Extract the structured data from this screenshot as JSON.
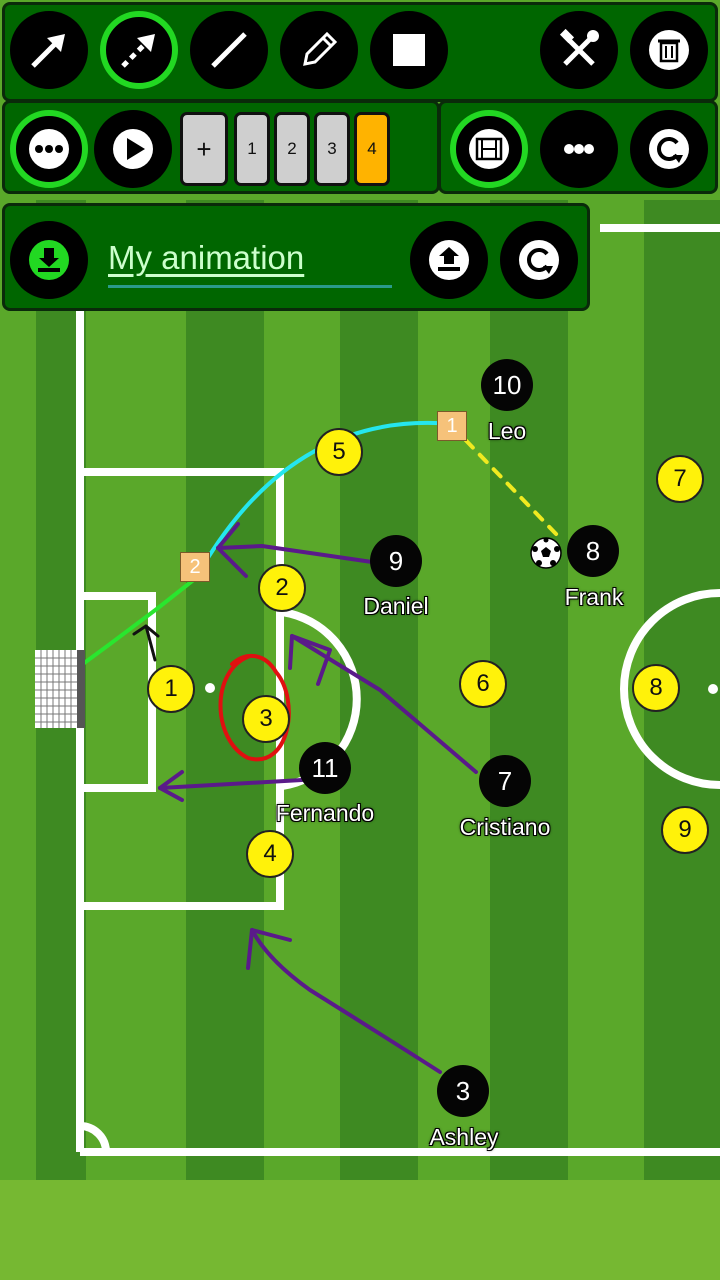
{
  "toolbar": {
    "row1": {
      "left_tools": [
        {
          "icon": "arrow-tool-icon",
          "active": false
        },
        {
          "icon": "dashed-arrow-tool-icon",
          "active": true
        },
        {
          "icon": "line-tool-icon",
          "active": false
        },
        {
          "icon": "pencil-tool-icon",
          "active": false
        },
        {
          "icon": "square-tool-icon",
          "active": false
        }
      ],
      "right_tools": [
        {
          "icon": "hammer-wrench-icon"
        },
        {
          "icon": "trash-icon"
        }
      ]
    },
    "row2": {
      "more_active": true,
      "play": "play-icon",
      "frames": {
        "add_label": "+",
        "labels": [
          "1",
          "2",
          "3",
          "4"
        ],
        "selected": "4"
      },
      "film_active": true,
      "more": "more-icon",
      "refresh": "refresh-icon"
    }
  },
  "animation_panel": {
    "title": "My animation",
    "save_icon": "download-icon",
    "upload_icon": "upload-icon",
    "refresh_icon": "refresh-icon"
  },
  "colors": {
    "panel_bg": "#006600",
    "active_ring": "#22d822",
    "selected_frame": "#ffb300",
    "team_yellow": "#fff20a",
    "team_black": "#050505",
    "arrow_purple": "#5a1a8a",
    "highlight_red": "#e01010",
    "path_cyan": "#25e6ee",
    "path_green": "#29e62e",
    "path_yellow": "#f0ea20"
  },
  "players": {
    "yellow": [
      "1",
      "2",
      "3",
      "4",
      "5",
      "6",
      "7",
      "8",
      "9"
    ],
    "black": [
      {
        "number": "10",
        "name": "Leo"
      },
      {
        "number": "8",
        "name": "Frank"
      },
      {
        "number": "9",
        "name": "Daniel"
      },
      {
        "number": "7",
        "name": "Cristiano"
      },
      {
        "number": "11",
        "name": "Fernando"
      },
      {
        "number": "3",
        "name": "Ashley"
      }
    ]
  },
  "markers": [
    "1",
    "2"
  ]
}
